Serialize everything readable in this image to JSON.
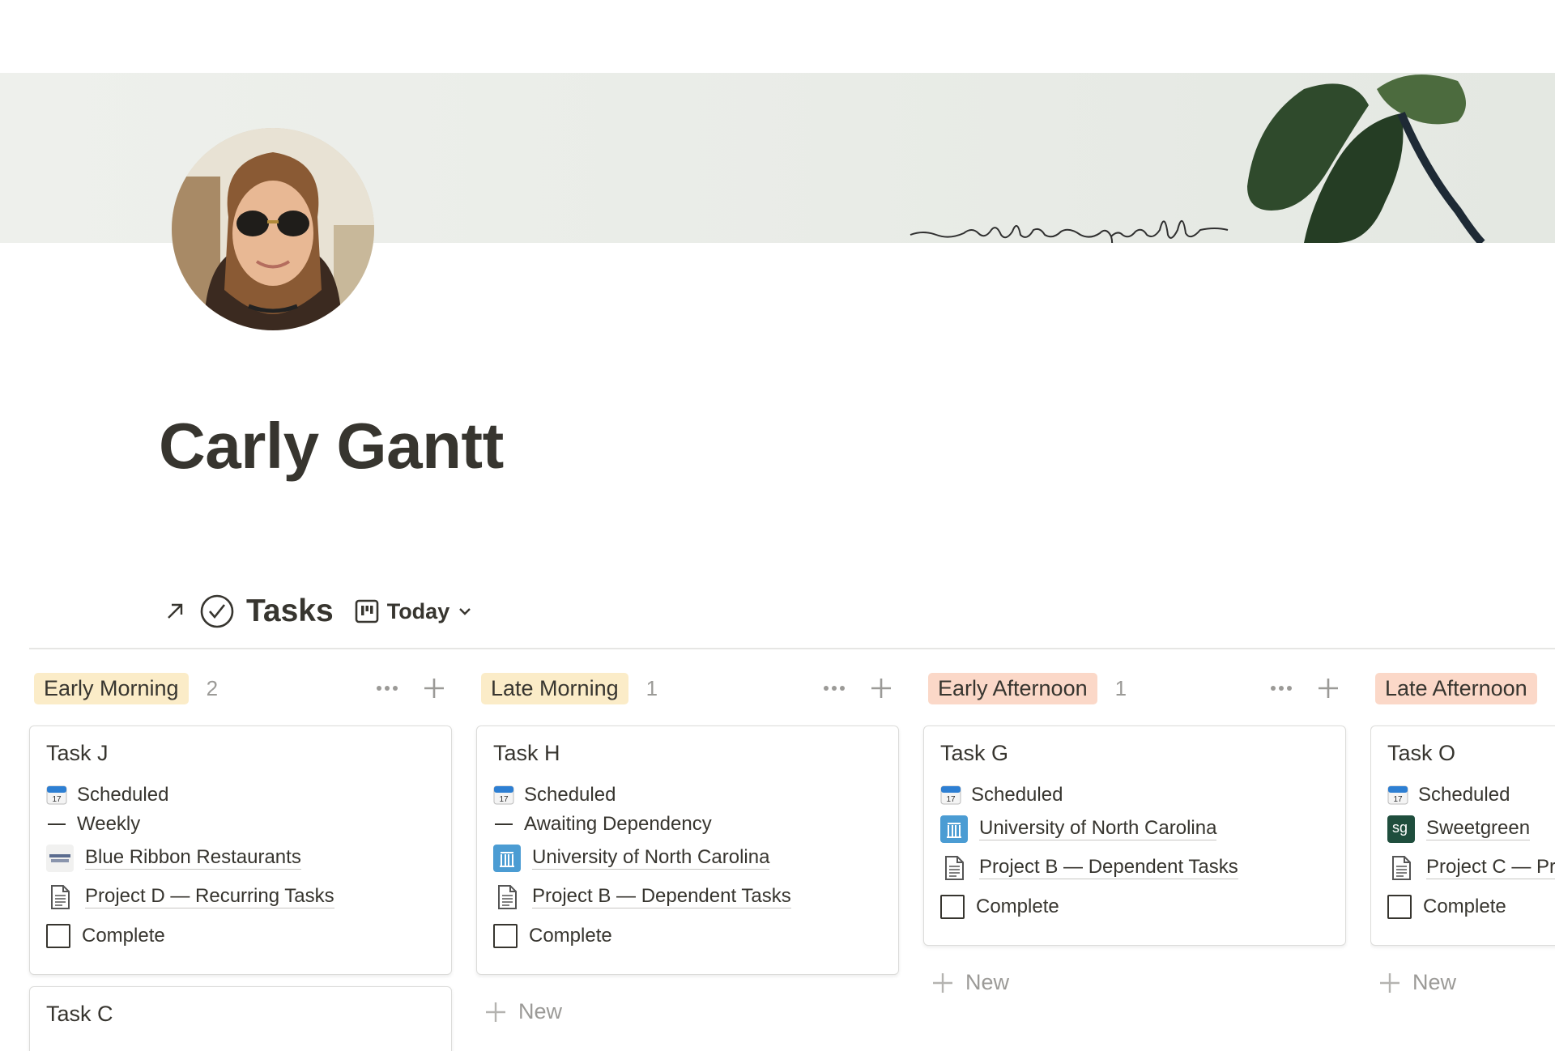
{
  "colors": {
    "early_morning": "#fbecc8",
    "late_morning": "#fbecc8",
    "early_afternoon": "#fbd8c8",
    "late_afternoon": "#fbd8c8",
    "text": "#37352f",
    "muted": "#9b9a97"
  },
  "page": {
    "title": "Carly Gantt"
  },
  "database": {
    "title": "Tasks",
    "view_label": "Today",
    "icons": [
      "open-arrow-icon",
      "check-circle-icon",
      "board-view-icon",
      "chevron-down-icon"
    ]
  },
  "columns": [
    {
      "label": "Early Morning",
      "count": "2",
      "cards": [
        {
          "title": "Task J",
          "date": "Scheduled",
          "recurrence": "Weekly",
          "client": "Blue Ribbon Restaurants",
          "project": "Project D — Recurring Tasks",
          "checkbox": "Complete"
        },
        {
          "title": "Task C"
        }
      ]
    },
    {
      "label": "Late Morning",
      "count": "1",
      "cards": [
        {
          "title": "Task H",
          "date": "Scheduled",
          "recurrence": "Awaiting Dependency",
          "client": "University of North Carolina",
          "project": "Project B — Dependent Tasks",
          "checkbox": "Complete"
        }
      ],
      "new_label": "New"
    },
    {
      "label": "Early Afternoon",
      "count": "1",
      "cards": [
        {
          "title": "Task G",
          "date": "Scheduled",
          "client": "University of North Carolina",
          "project": "Project B — Dependent Tasks",
          "checkbox": "Complete"
        }
      ],
      "new_label": "New"
    },
    {
      "label": "Late Afternoon",
      "cards": [
        {
          "title": "Task O",
          "date": "Scheduled",
          "client": "Sweetgreen",
          "client_badge": "sg",
          "project": "Project C — Pr",
          "checkbox": "Complete"
        }
      ],
      "new_label": "New"
    }
  ]
}
